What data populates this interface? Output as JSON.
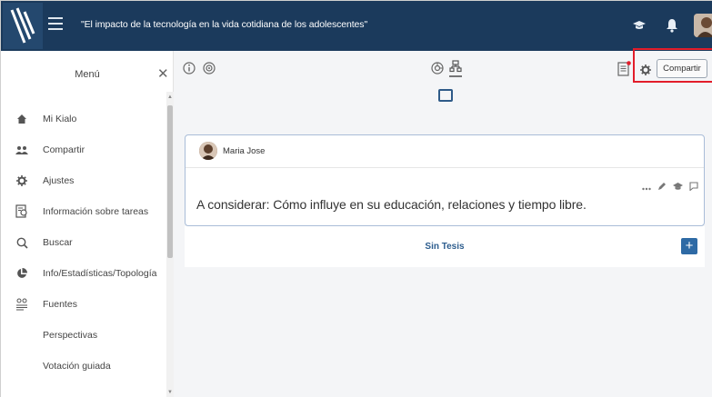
{
  "header": {
    "title": "\"El impacto de la tecnología en la vida cotidiana de los adolescentes\"",
    "logo_icon": "kialo-logo-icon",
    "menu_icon": "hamburger-icon",
    "icons": [
      "graduation-cap-icon",
      "bell-icon",
      "user-avatar"
    ],
    "background_color": "#1b3a5c"
  },
  "sidebar": {
    "title": "Menú",
    "close_icon": "close-icon",
    "items": [
      {
        "label": "Mi Kialo",
        "icon": "home-icon"
      },
      {
        "label": "Compartir",
        "icon": "users-icon"
      },
      {
        "label": "Ajustes",
        "icon": "gear-icon"
      },
      {
        "label": "Información sobre tareas",
        "icon": "task-info-icon"
      },
      {
        "label": "Buscar",
        "icon": "search-icon"
      },
      {
        "label": "Info/Estadísticas/Topología",
        "icon": "pie-chart-icon"
      },
      {
        "label": "Fuentes",
        "icon": "sources-icon"
      },
      {
        "label": "Perspectivas",
        "icon": ""
      },
      {
        "label": "Votación guiada",
        "icon": ""
      }
    ]
  },
  "toolbar": {
    "left_icons": [
      "info-icon",
      "target-icon"
    ],
    "center_icons": [
      "sunburst-icon",
      "tree-view-icon",
      "box-view-icon"
    ],
    "right_icons": [
      "notes-icon",
      "settings-icon"
    ],
    "share_label": "Compartir",
    "highlight_color": "#e21d2a"
  },
  "claim": {
    "author": "Maria Jose",
    "text": "A considerar: Cómo influye en su educación, relaciones y tiempo libre.",
    "actions": [
      "more-icon",
      "edit-icon",
      "education-icon",
      "comment-icon"
    ]
  },
  "thesis": {
    "label": "Sin Tesis",
    "add_label": "+"
  }
}
